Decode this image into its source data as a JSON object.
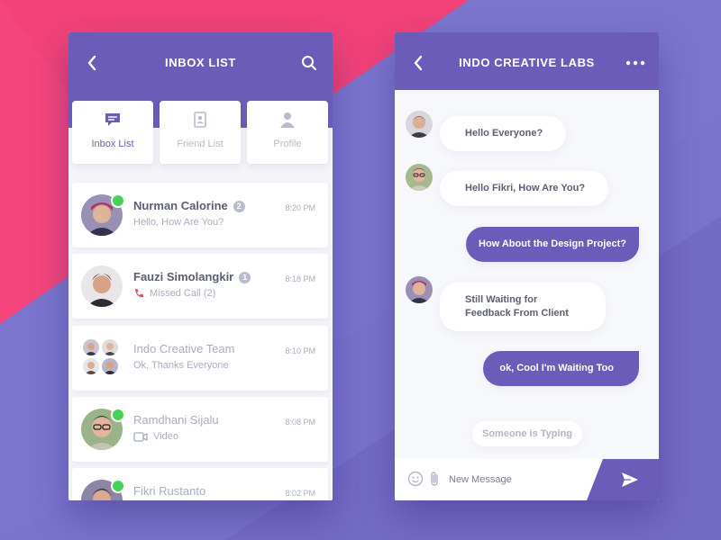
{
  "colors": {
    "primary": "#6c5cb9",
    "accent_pink": "#f4467c",
    "online": "#44d356",
    "bg": "#7b73cc"
  },
  "inbox": {
    "title": "INBOX LIST",
    "tabs": [
      {
        "label": "Inbox List",
        "icon": "chat-bubble-icon",
        "active": true
      },
      {
        "label": "Friend List",
        "icon": "contacts-book-icon",
        "active": false
      },
      {
        "label": "Profile",
        "icon": "user-icon",
        "active": false
      }
    ],
    "conversations": [
      {
        "name": "Nurman Calorine",
        "badge": "2",
        "preview": "Hello, How Are You?",
        "time": "8:20 PM",
        "online": true
      },
      {
        "name": "Fauzi Simolangkir",
        "badge": "1",
        "preview": "Missed Call (2)",
        "preview_icon": "phone-icon",
        "time": "8:18 PM",
        "online": false
      },
      {
        "name": "Indo Creative Team",
        "badge": "",
        "preview": "Ok, Thanks Everyone",
        "time": "8:10 PM",
        "online": false
      },
      {
        "name": "Ramdhani Sijalu",
        "badge": "",
        "preview": "Video",
        "preview_icon": "video-icon",
        "time": "8:08 PM",
        "online": true
      },
      {
        "name": "Fikri Rustanto",
        "badge": "",
        "preview": "",
        "time": "8:02 PM",
        "online": true
      }
    ]
  },
  "chat": {
    "title": "INDO CREATIVE LABS",
    "messages": [
      {
        "text": "Hello Everyone?",
        "direction": "in"
      },
      {
        "text": "Hello Fikri, How Are You?",
        "direction": "in"
      },
      {
        "text": "How About the Design Project?",
        "direction": "out"
      },
      {
        "text": "Still Waiting for Feedback From Client",
        "direction": "in"
      },
      {
        "text": "ok, Cool I'm Waiting Too",
        "direction": "out"
      }
    ],
    "typing_text": "Someone is Typing",
    "composer": {
      "placeholder": "New Message",
      "value": ""
    }
  }
}
